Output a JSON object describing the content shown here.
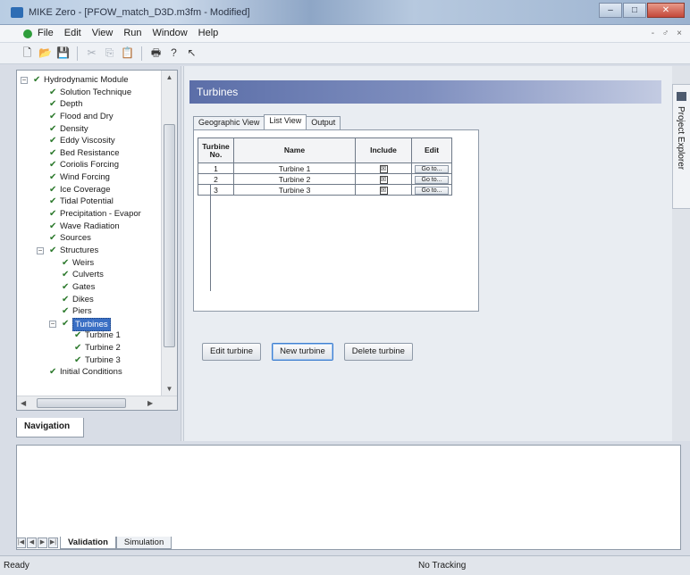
{
  "window": {
    "title": "MIKE Zero - [PFOW_match_D3D.m3fm - Modified]",
    "controls": [
      "–",
      "□",
      "✕"
    ]
  },
  "menu": {
    "items": [
      "File",
      "Edit",
      "View",
      "Run",
      "Window",
      "Help"
    ],
    "mdi_controls": "- ♂ ×"
  },
  "toolbar": {
    "buttons": [
      {
        "name": "new-icon",
        "glyph": "🗋",
        "enabled": true
      },
      {
        "name": "open-icon",
        "glyph": "📂",
        "enabled": true
      },
      {
        "name": "save-icon",
        "glyph": "💾",
        "enabled": true
      },
      {
        "name": "cut-icon",
        "glyph": "✂",
        "enabled": false
      },
      {
        "name": "copy-icon",
        "glyph": "⎘",
        "enabled": false
      },
      {
        "name": "paste-icon",
        "glyph": "📋",
        "enabled": false
      },
      {
        "name": "print-icon",
        "glyph": "🖶",
        "enabled": true
      },
      {
        "name": "help-icon",
        "glyph": "?",
        "enabled": true
      },
      {
        "name": "context-help-icon",
        "glyph": "↖",
        "enabled": true
      }
    ]
  },
  "navigation": {
    "tab_label": "Navigation",
    "tree": [
      {
        "label": "Hydrodynamic Module",
        "level": 0,
        "expander": "−",
        "checked": true
      },
      {
        "label": "Solution Technique",
        "level": 1,
        "checked": true
      },
      {
        "label": "Depth",
        "level": 1,
        "checked": true
      },
      {
        "label": "Flood and Dry",
        "level": 1,
        "checked": true
      },
      {
        "label": "Density",
        "level": 1,
        "checked": true
      },
      {
        "label": "Eddy Viscosity",
        "level": 1,
        "checked": true
      },
      {
        "label": "Bed Resistance",
        "level": 1,
        "checked": true
      },
      {
        "label": "Coriolis Forcing",
        "level": 1,
        "checked": true
      },
      {
        "label": "Wind Forcing",
        "level": 1,
        "checked": true
      },
      {
        "label": "Ice Coverage",
        "level": 1,
        "checked": true
      },
      {
        "label": "Tidal Potential",
        "level": 1,
        "checked": true
      },
      {
        "label": "Precipitation - Evapor",
        "level": 1,
        "checked": true
      },
      {
        "label": "Wave Radiation",
        "level": 1,
        "checked": true
      },
      {
        "label": "Sources",
        "level": 1,
        "checked": true
      },
      {
        "label": "Structures",
        "level": 1,
        "expander": "−",
        "checked": true
      },
      {
        "label": "Weirs",
        "level": 2,
        "checked": true
      },
      {
        "label": "Culverts",
        "level": 2,
        "checked": true
      },
      {
        "label": "Gates",
        "level": 2,
        "checked": true
      },
      {
        "label": "Dikes",
        "level": 2,
        "checked": true
      },
      {
        "label": "Piers",
        "level": 2,
        "checked": true
      },
      {
        "label": "Turbines",
        "level": 2,
        "expander": "−",
        "checked": true,
        "selected": true
      },
      {
        "label": "Turbine 1",
        "level": 3,
        "checked": true
      },
      {
        "label": "Turbine 2",
        "level": 3,
        "checked": true
      },
      {
        "label": "Turbine 3",
        "level": 3,
        "checked": true
      },
      {
        "label": "Initial Conditions",
        "level": 1,
        "checked": true
      }
    ]
  },
  "main": {
    "header": "Turbines",
    "tabs": [
      {
        "label": "Geographic View",
        "active": false
      },
      {
        "label": "List View",
        "active": true
      },
      {
        "label": "Output",
        "active": false
      }
    ],
    "table": {
      "headers": {
        "no": "Turbine No.",
        "name": "Name",
        "include": "Include",
        "edit": "Edit"
      },
      "rows": [
        {
          "no": "1",
          "name": "Turbine 1",
          "include": "☒",
          "edit": "Go to..."
        },
        {
          "no": "2",
          "name": "Turbine 2",
          "include": "☒",
          "edit": "Go to..."
        },
        {
          "no": "3",
          "name": "Turbine 3",
          "include": "☒",
          "edit": "Go to..."
        }
      ]
    },
    "buttons": {
      "edit": "Edit turbine",
      "new": "New turbine",
      "delete": "Delete turbine"
    }
  },
  "project_explorer": {
    "label": "Project Explorer"
  },
  "bottom": {
    "tabs": [
      {
        "label": "Validation",
        "active": true
      },
      {
        "label": "Simulation",
        "active": false
      }
    ]
  },
  "status": {
    "left": "Ready",
    "middle": "No Tracking"
  },
  "colors": {
    "header_gradient_start": "#5b6ea8",
    "selection": "#3a6fc4",
    "check": "#2d7a2d"
  }
}
